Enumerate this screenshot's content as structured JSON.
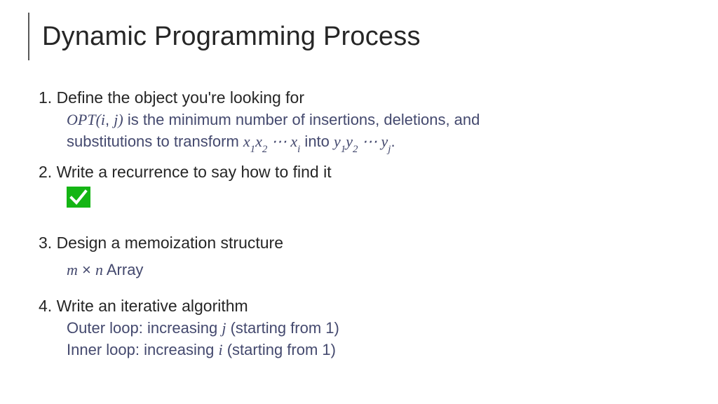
{
  "title": "Dynamic Programming Process",
  "steps": {
    "s1": {
      "head": "1. Define the object you're looking for"
    },
    "s2": {
      "head": "2. Write a recurrence to say how to find it"
    },
    "s3": {
      "head": "3. Design a memoization structure"
    },
    "s4": {
      "head": "4. Write an iterative algorithm"
    }
  },
  "def": {
    "opt_func": "OPT",
    "opt_args_open": "(",
    "opt_arg_i": "i",
    "opt_args_comma": ", ",
    "opt_arg_j": "j",
    "opt_args_close": ")",
    "rest1": " is the minimum number of insertions, deletions, and",
    "rest2_a": "substitutions to transform ",
    "x": "x",
    "one": "1",
    "two": "2",
    "dots": " ⋯ ",
    "i": "i",
    "rest2_b": " into ",
    "y": "y",
    "j": "j",
    "period": "."
  },
  "memo": {
    "m": "m",
    "times": " × ",
    "n": "n",
    "label": " Array"
  },
  "iter": {
    "outer_a": "Outer loop: increasing ",
    "outer_j": "j",
    "outer_b": " (starting from 1)",
    "inner_a": "Inner loop: increasing ",
    "inner_i": "i",
    "inner_b": " (starting from 1)"
  }
}
